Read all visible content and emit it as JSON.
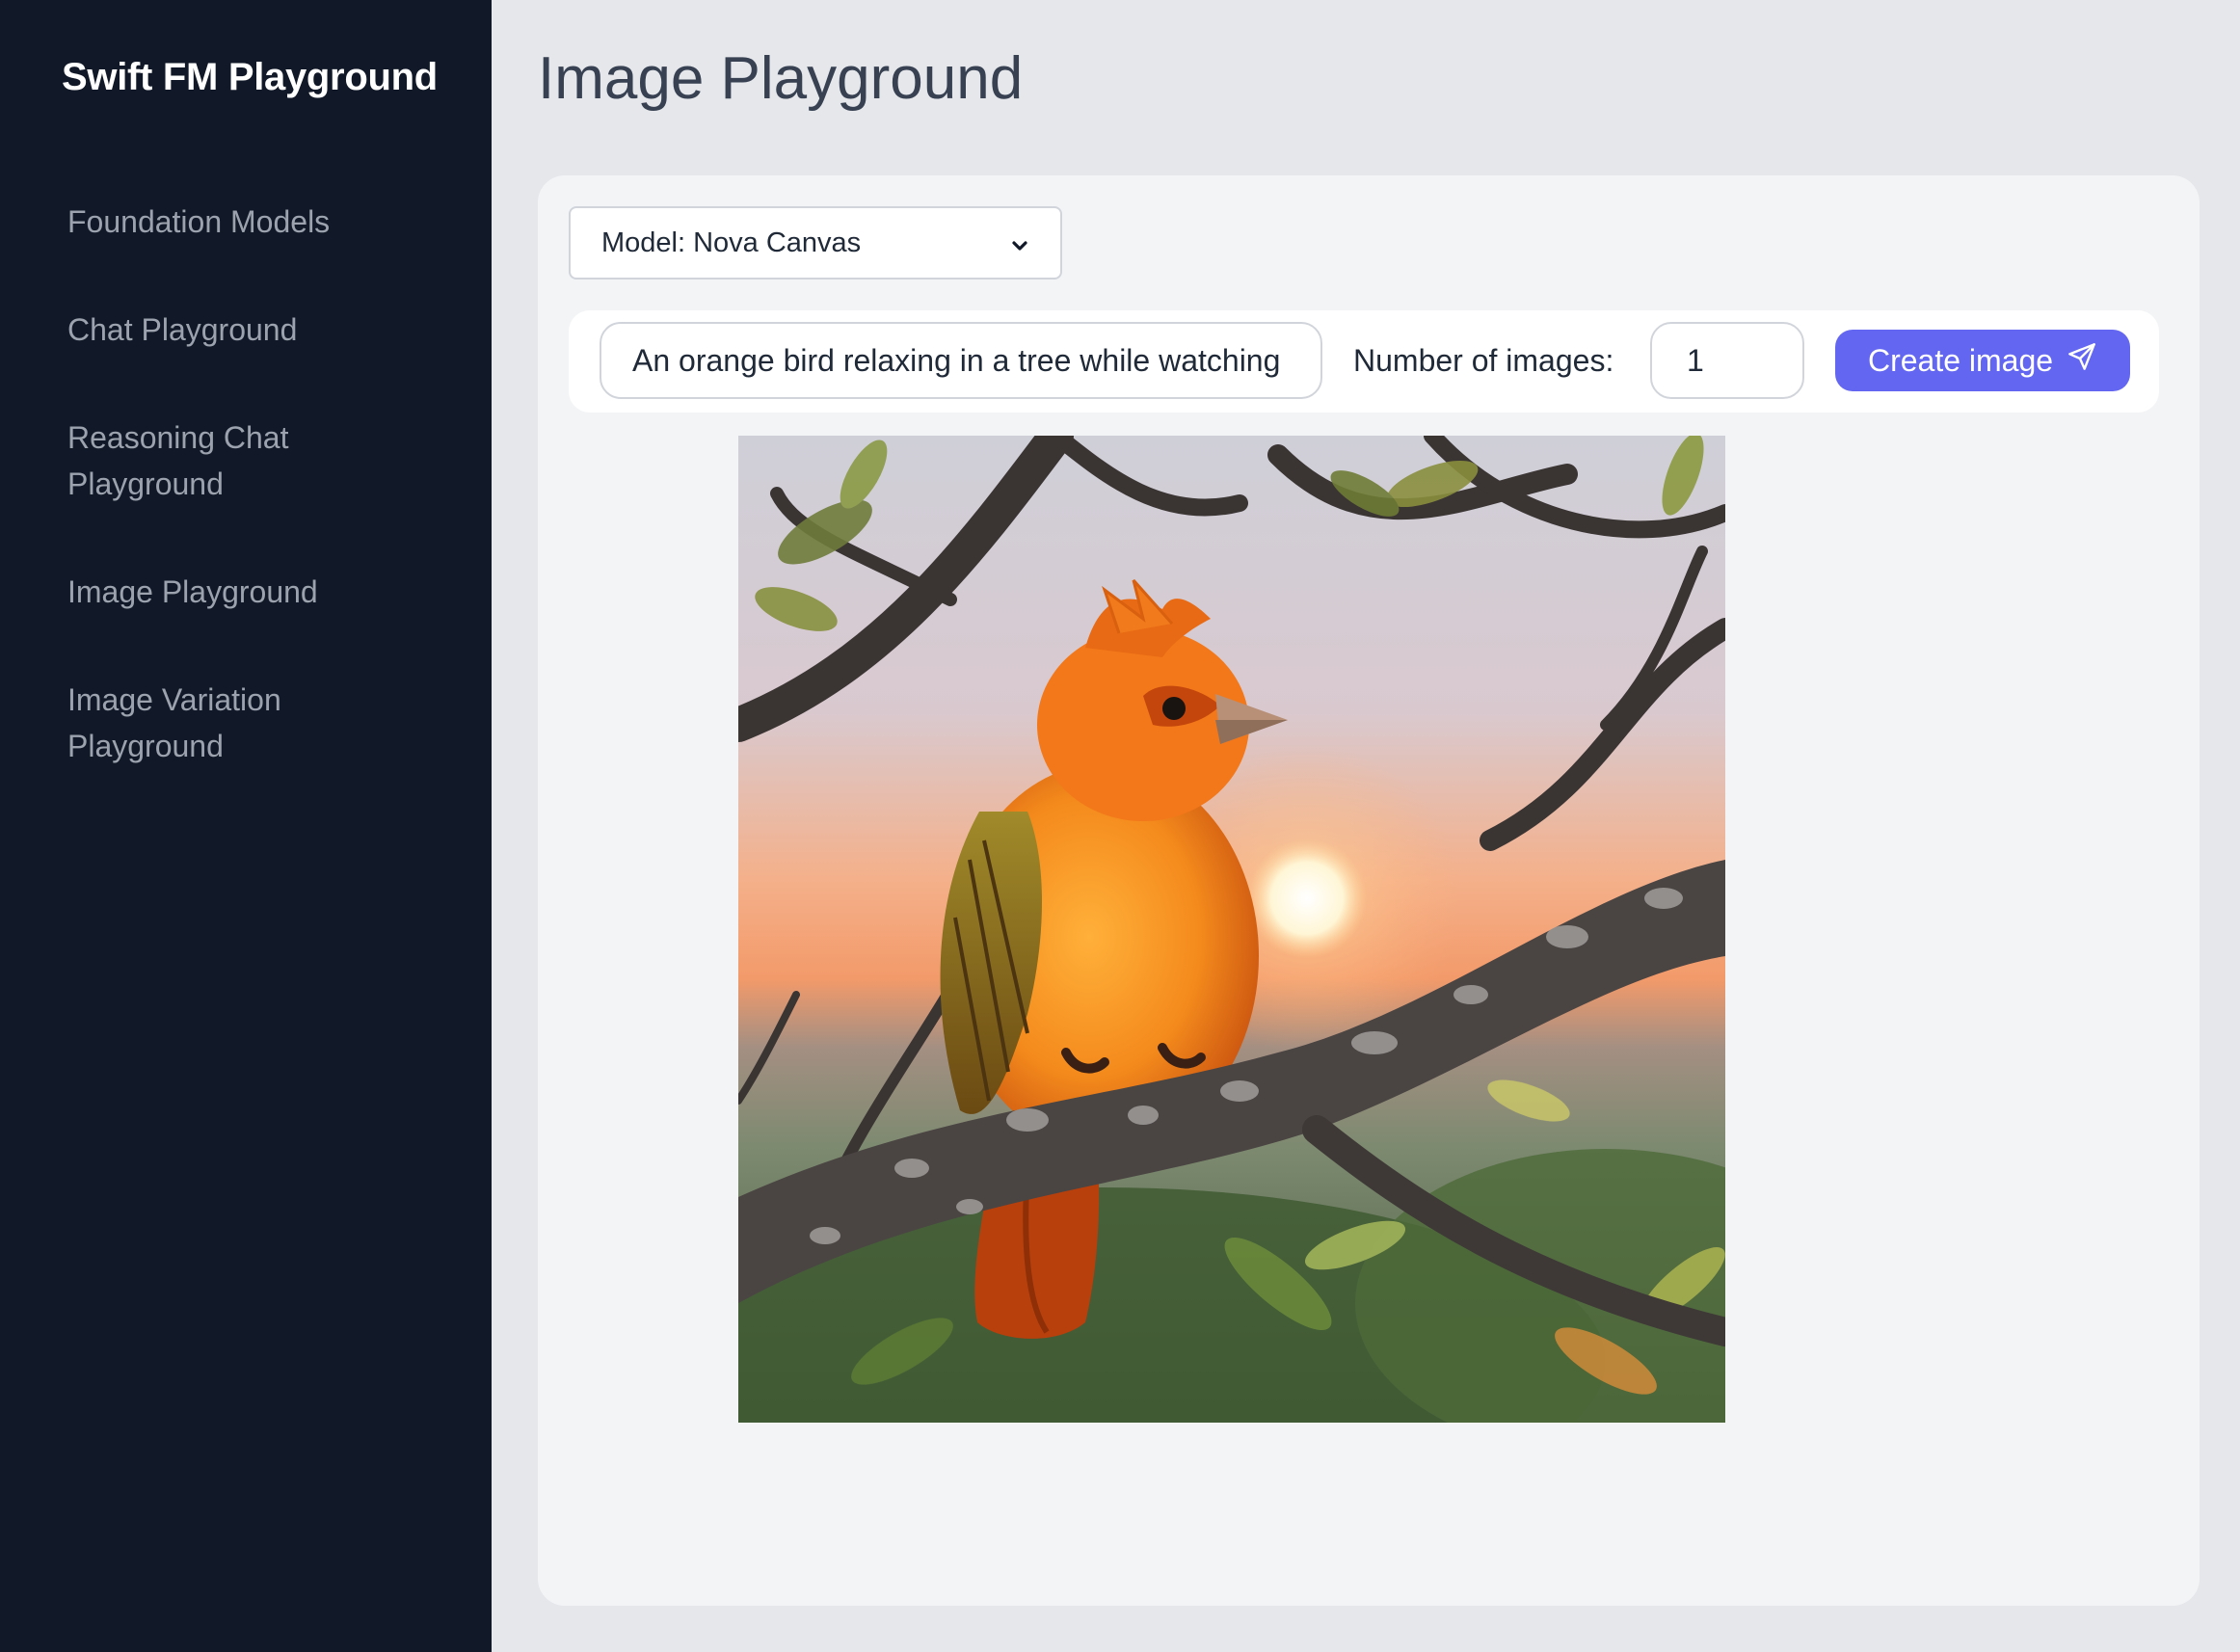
{
  "sidebar": {
    "brand": "Swift FM Playground",
    "items": [
      {
        "label": "Foundation Models"
      },
      {
        "label": "Chat Playground"
      },
      {
        "label": "Reasoning Chat Playground"
      },
      {
        "label": "Image Playground"
      },
      {
        "label": "Image Variation Playground"
      }
    ]
  },
  "main": {
    "title": "Image Playground",
    "model_select": {
      "value": "Model: Nova Canvas",
      "icon": "chevron-down-icon"
    },
    "prompt": {
      "value": "An orange bird relaxing in a tree while watching a"
    },
    "num_images": {
      "label": "Number of images:",
      "value": "1"
    },
    "create_button": {
      "label": "Create image",
      "icon": "send-icon"
    },
    "accent_color": "#6366f1"
  }
}
